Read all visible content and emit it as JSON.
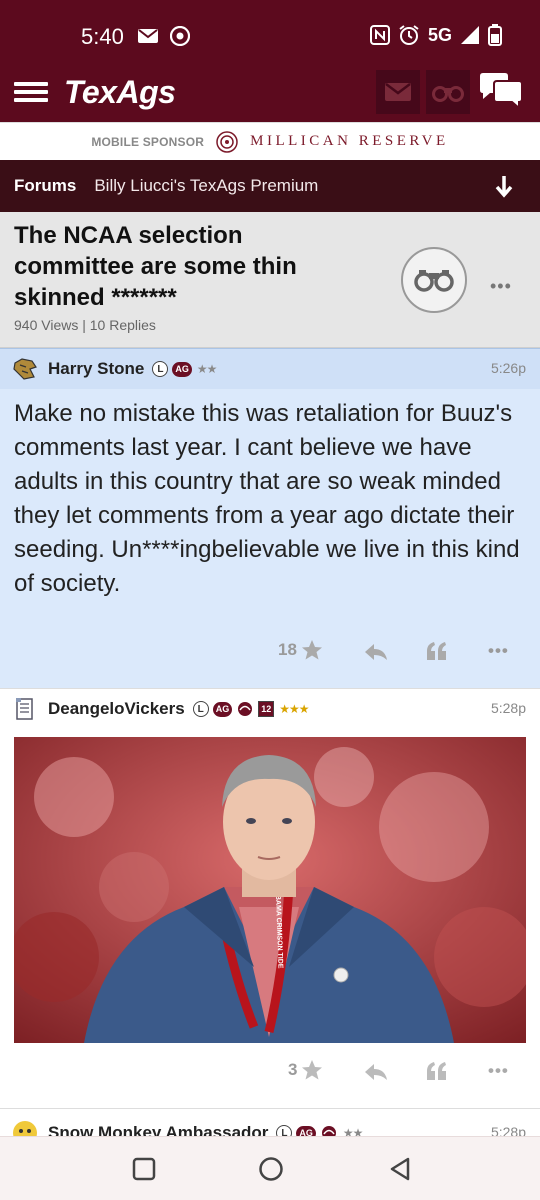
{
  "status_bar": {
    "time": "5:40",
    "network": "5G"
  },
  "header": {
    "logo": "TexAgs"
  },
  "sponsor": {
    "label": "MOBILE SPONSOR",
    "name": "MILLICAN RESERVE"
  },
  "forum_bar": {
    "forums_label": "Forums",
    "forum_name": "Billy Liucci's TexAgs Premium"
  },
  "thread": {
    "title": "The NCAA selection committee are some thin skinned *******",
    "meta": "940 Views | 10 Replies"
  },
  "posts": [
    {
      "username": "Harry Stone",
      "badge_l": "L",
      "badge_ag": "AG",
      "stars": "★★",
      "time": "5:26p",
      "body": "Make no mistake this was retaliation for Buuz's comments last year. I cant believe we have adults in this country that are so weak minded they let comments from a year ago dictate their seeding. Un****ingbelievable we live in this kind of society.",
      "star_count": "18"
    },
    {
      "username": "DeangeloVickers",
      "badge_l": "L",
      "badge_ag": "AG",
      "badge_num": "12",
      "stars": "★★★",
      "time": "5:28p",
      "star_count": "3",
      "lanyard_text": "BAMA CRIMSON TIDE"
    },
    {
      "username": "Snow Monkey Ambassador",
      "badge_l": "L",
      "badge_ag": "AG",
      "stars": "★★",
      "time": "5:28p"
    }
  ],
  "colors": {
    "maroon": "#5c0a1e",
    "dark_forum": "#3a0e16",
    "post_bg": "#dbe9fb"
  }
}
